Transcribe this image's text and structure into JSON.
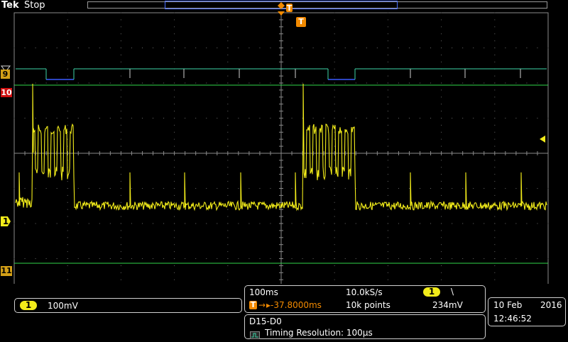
{
  "header": {
    "brand": "Tek",
    "acq_state": "Stop",
    "trigger_marker_label": "T"
  },
  "colors": {
    "channel1": "#f2ec1a",
    "digital": "#3ed6a8",
    "digital_low": "#3b5bff",
    "ref_lines": "#2fd64a",
    "trigger": "#f28a00",
    "digital_marker_9": "#d4a017",
    "digital_marker_10": "#d01010"
  },
  "channel_markers": {
    "ch1": "1",
    "d9": "9",
    "d10": "10",
    "d11": "11"
  },
  "ch1_scale": {
    "badge": "1",
    "value": "100mV"
  },
  "timebase": {
    "time_per_div": "100ms",
    "sample_rate": "10.0kS/s",
    "trigger_channel_badge": "1",
    "trigger_slope_glyph": "\\",
    "delay_prefix_icon": "T",
    "delay": "▸-37.8000ms",
    "record_length": "10k points",
    "trigger_level": "234mV"
  },
  "date_time": {
    "date": "10 Feb",
    "year": "2016",
    "time": "12:46:52"
  },
  "digital_info": {
    "bus": "D15-D0",
    "resolution_icon": "timing-resolution-icon",
    "resolution": "Timing Resolution: 100µs"
  }
}
